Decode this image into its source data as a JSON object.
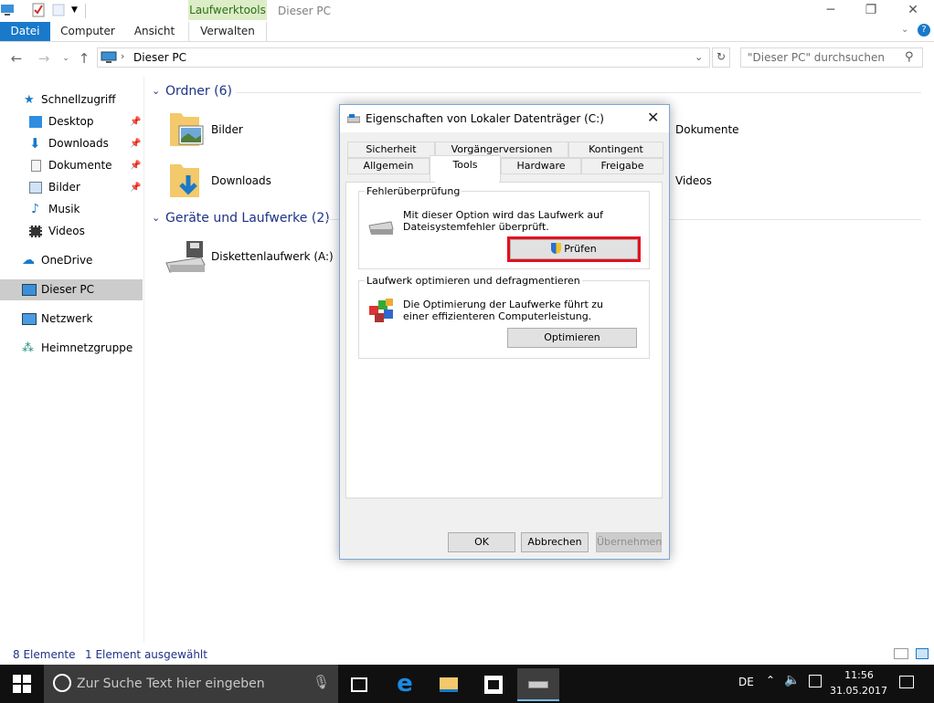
{
  "window": {
    "title": "Dieser PC",
    "context_tab": "Laufwerktools"
  },
  "ribbon": {
    "tabs": [
      "Datei",
      "Computer",
      "Ansicht",
      "Verwalten"
    ]
  },
  "address": {
    "path": "Dieser PC",
    "search_placeholder": "\"Dieser PC\" durchsuchen"
  },
  "sidebar": {
    "items": [
      {
        "label": "Schnellzugriff",
        "icon": "star-icon"
      },
      {
        "label": "Desktop",
        "icon": "desktop-icon",
        "pinned": true
      },
      {
        "label": "Downloads",
        "icon": "download-icon",
        "pinned": true
      },
      {
        "label": "Dokumente",
        "icon": "document-icon",
        "pinned": true
      },
      {
        "label": "Bilder",
        "icon": "pictures-icon",
        "pinned": true
      },
      {
        "label": "Musik",
        "icon": "music-icon"
      },
      {
        "label": "Videos",
        "icon": "video-icon"
      },
      {
        "label": "OneDrive",
        "icon": "cloud-icon"
      },
      {
        "label": "Dieser PC",
        "icon": "computer-icon",
        "selected": true
      },
      {
        "label": "Netzwerk",
        "icon": "network-icon"
      },
      {
        "label": "Heimnetzgruppe",
        "icon": "homegroup-icon"
      }
    ]
  },
  "content": {
    "folders_header": "Ordner (6)",
    "folders": [
      "Bilder",
      "Dokumente",
      "Downloads",
      "Videos"
    ],
    "devices_header": "Geräte und Laufwerke (2)",
    "devices": [
      "Diskettenlaufwerk (A:)"
    ]
  },
  "status": {
    "count": "8 Elemente",
    "selected": "1 Element ausgewählt"
  },
  "taskbar": {
    "search_placeholder": "Zur Suche Text hier eingeben",
    "lang": "DE",
    "time": "11:56",
    "date": "31.05.2017"
  },
  "dialog": {
    "title": "Eigenschaften von Lokaler Datenträger (C:)",
    "tabs_row1": [
      "Sicherheit",
      "Vorgängerversionen",
      "Kontingent"
    ],
    "tabs_row2": [
      "Allgemein",
      "Tools",
      "Hardware",
      "Freigabe"
    ],
    "active_tab": "Tools",
    "check": {
      "title": "Fehlerüberprüfung",
      "text": "Mit dieser Option wird das Laufwerk auf Dateisystemfehler überprüft.",
      "button": "Prüfen"
    },
    "optimize": {
      "title": "Laufwerk optimieren und defragmentieren",
      "text": "Die Optimierung der Laufwerke führt zu einer effizienteren Computerleistung.",
      "button": "Optimieren"
    },
    "buttons": {
      "ok": "OK",
      "cancel": "Abbrechen",
      "apply": "Übernehmen"
    }
  },
  "colors": {
    "accent": "#1979ca",
    "highlight": "#e3101f",
    "context_tab": "#dcedc8"
  }
}
